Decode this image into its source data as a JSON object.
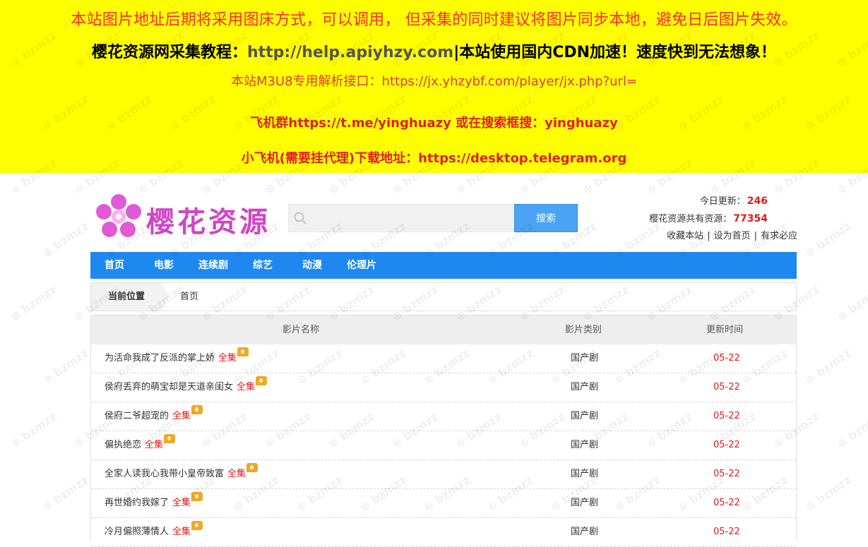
{
  "notice": {
    "line1": "本站图片地址后期将采用图床方式，可以调用， 但采集的同时建议将图片同步本地，避免日后图片失效。",
    "line2_prefix": "樱花资源网采集教程：",
    "line2_link": "http://help.apiyhzy.com",
    "line2_suffix": "|本站使用国内CDN加速！速度快到无法想象！",
    "line3": "本站M3U8专用解析接口：https://jx.yhzybf.com/player/jx.php?url=",
    "line4": "飞机群https://t.me/yinghuazy 或在搜索框搜：yinghuazy",
    "line5": "小飞机(需要挂代理)下载地址：https://desktop.telegram.org"
  },
  "logo": {
    "text": "樱花资源"
  },
  "search": {
    "value": "",
    "button_label": "搜索",
    "icon": "search-icon"
  },
  "stats": {
    "today_label": "今日更新：",
    "today_count": "246",
    "total_label": "樱花资源共有资源：",
    "total_count": "77354",
    "links": [
      "收藏本站",
      "设为首页",
      "有求必应"
    ],
    "separator": "|"
  },
  "nav": {
    "items": [
      "首页",
      "电影",
      "连续剧",
      "综艺",
      "动漫",
      "伦理片"
    ]
  },
  "breadcrumb": {
    "current_label": "当前位置",
    "home": "首页"
  },
  "table": {
    "headers": [
      "影片名称",
      "影片类别",
      "更新时间"
    ],
    "rows": [
      {
        "name": "为活命我成了反派的掌上娇",
        "tag": "全集",
        "category": "国产剧",
        "date": "05-22"
      },
      {
        "name": "侯府丢弃的萌宝却是天道亲闺女",
        "tag": "全集",
        "category": "国产剧",
        "date": "05-22"
      },
      {
        "name": "侯府二爷超宠的",
        "tag": "全集",
        "category": "国产剧",
        "date": "05-22"
      },
      {
        "name": "偏执绝恋",
        "tag": "全集",
        "category": "国产剧",
        "date": "05-22"
      },
      {
        "name": "全家人读我心我带小皇帝致富",
        "tag": "全集",
        "category": "国产剧",
        "date": "05-22"
      },
      {
        "name": "再世婚约我嫁了",
        "tag": "全集",
        "category": "国产剧",
        "date": "05-22"
      },
      {
        "name": "冷月偏照薄情人",
        "tag": "全集",
        "category": "国产剧",
        "date": "05-22"
      }
    ]
  },
  "colors": {
    "notice_bg": "#ffff00",
    "nav_bg": "#1e88f0",
    "accent_red": "#e81818",
    "button_blue": "#4aa3f5",
    "logo_pink": "#d046c6"
  }
}
